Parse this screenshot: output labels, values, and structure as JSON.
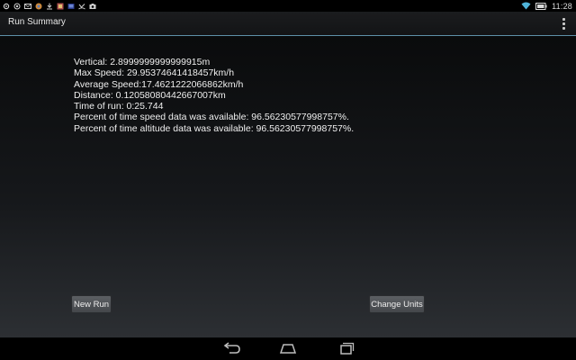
{
  "status_bar": {
    "time": "11:28",
    "notification_icons": [
      "settings-icon",
      "radio-icon",
      "mail-icon",
      "browser-icon",
      "download-icon",
      "photo-icon",
      "tv-icon",
      "missed-call-icon",
      "camera-icon"
    ],
    "status_icons": [
      "wifi-icon",
      "battery-icon"
    ]
  },
  "action_bar": {
    "title": "Run Summary",
    "overflow_icon": "overflow-menu-icon"
  },
  "stats": {
    "vertical": "Vertical: 2.8999999999999915m",
    "max_speed": "Max Speed: 29.95374641418457km/h",
    "average_speed": "Average Speed:17.4621222066862km/h",
    "distance": "Distance: 0.12058080442667007km",
    "time_of_run": "Time of run: 0:25.744",
    "speed_availability": "Percent of time speed data was available: 96.56230577998757%.",
    "altitude_availability": "Percent of time altitude data was available: 96.56230577998757%."
  },
  "buttons": {
    "new_run": "New Run",
    "change_units": "Change Units"
  },
  "nav_bar": {
    "icons": [
      "back-icon",
      "home-icon",
      "recents-icon"
    ]
  },
  "colors": {
    "accent": "#5e90a8",
    "button": "#505357",
    "text": "#efefef"
  }
}
